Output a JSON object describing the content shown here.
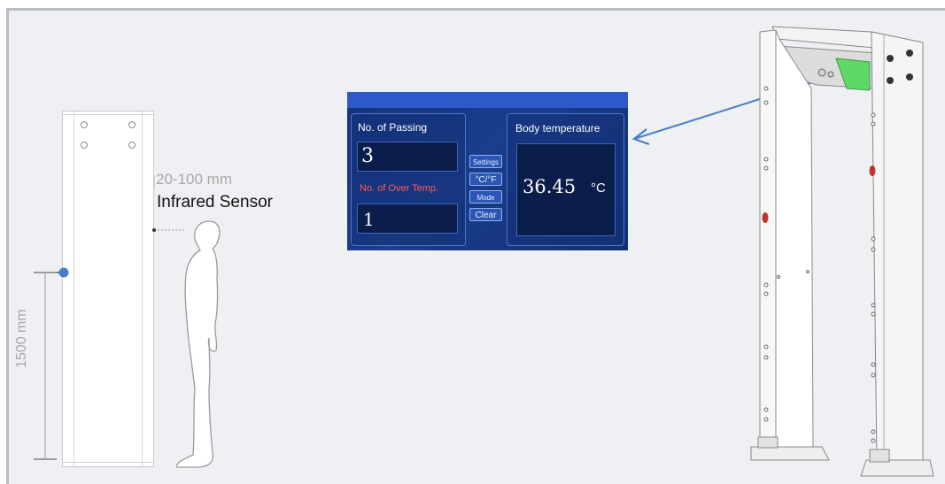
{
  "labels": {
    "gap": "20-100 mm",
    "sensor": "Infrared Sensor",
    "height": "1500 mm"
  },
  "display": {
    "passing_label": "No. of Passing",
    "passing_value": "3",
    "over_temp_label": "No. of Over Temp.",
    "over_temp_value": "1",
    "body_temp_label": "Body temperature",
    "temperature_value": "36.45",
    "temperature_unit": "°C",
    "buttons": [
      "Settings",
      "°C/°F",
      "Mode",
      "Clear"
    ]
  },
  "colors": {
    "screen_bg": "#1a3d8c",
    "over_temp_text": "#ff5a5a",
    "marker_dot": "#4a7ec8",
    "arrow": "#4a7ec8",
    "sensor_window": "#5fd86a",
    "indicator_light": "#c0322c"
  }
}
